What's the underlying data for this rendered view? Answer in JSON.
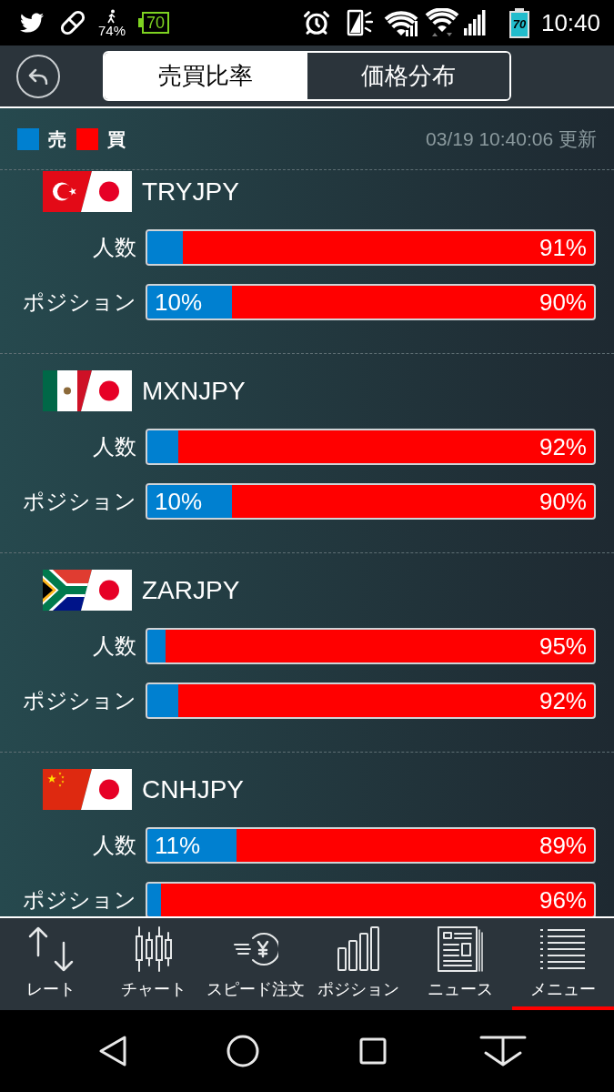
{
  "status_bar": {
    "notification_percent": "74%",
    "notification_battery": "70",
    "battery": "70",
    "time": "10:40"
  },
  "header": {
    "tabs": [
      {
        "label": "売買比率",
        "selected": true
      },
      {
        "label": "価格分布",
        "selected": false
      }
    ]
  },
  "legend": [
    {
      "label": "売",
      "color": "#0080d0"
    },
    {
      "label": "買",
      "color": "#ff0000"
    }
  ],
  "updated": "03/19 10:40:06 更新",
  "pairs": [
    {
      "name": "TRYJPY",
      "kind": "turkey",
      "rows": [
        {
          "label": "人数",
          "level": 0.08,
          "buy_percent": "91%"
        },
        {
          "label": "ポジション",
          "level": 0.19,
          "sell_percent": "10%",
          "buy_percent": "90%"
        }
      ]
    },
    {
      "name": "MXNJPY",
      "kind": "mexico",
      "rows": [
        {
          "label": "人数",
          "level": 0.07,
          "buy_percent": "92%"
        },
        {
          "label": "ポジション",
          "level": 0.19,
          "sell_percent": "10%",
          "buy_percent": "90%"
        }
      ]
    },
    {
      "name": "ZARJPY",
      "kind": "southafrica",
      "rows": [
        {
          "label": "人数",
          "level": 0.04,
          "buy_percent": "95%"
        },
        {
          "label": "ポジション",
          "level": 0.07,
          "buy_percent": "92%"
        }
      ]
    },
    {
      "name": "CNHJPY",
      "kind": "china",
      "rows": [
        {
          "label": "人数",
          "level": 0.2,
          "sell_percent": "11%",
          "buy_percent": "89%"
        },
        {
          "label": "ポジション",
          "level": 0.03,
          "buy_percent": "96%"
        }
      ]
    }
  ],
  "bottom_nav": [
    {
      "label": "レート",
      "kind": "rate",
      "selected": false
    },
    {
      "label": "チャート",
      "kind": "chart",
      "selected": false
    },
    {
      "label": "スピード注文",
      "kind": "speed",
      "selected": false
    },
    {
      "label": "ポジション",
      "kind": "position",
      "selected": false
    },
    {
      "label": "ニュース",
      "kind": "news",
      "selected": false
    },
    {
      "label": "メニュー",
      "kind": "menu",
      "selected": true
    }
  ]
}
